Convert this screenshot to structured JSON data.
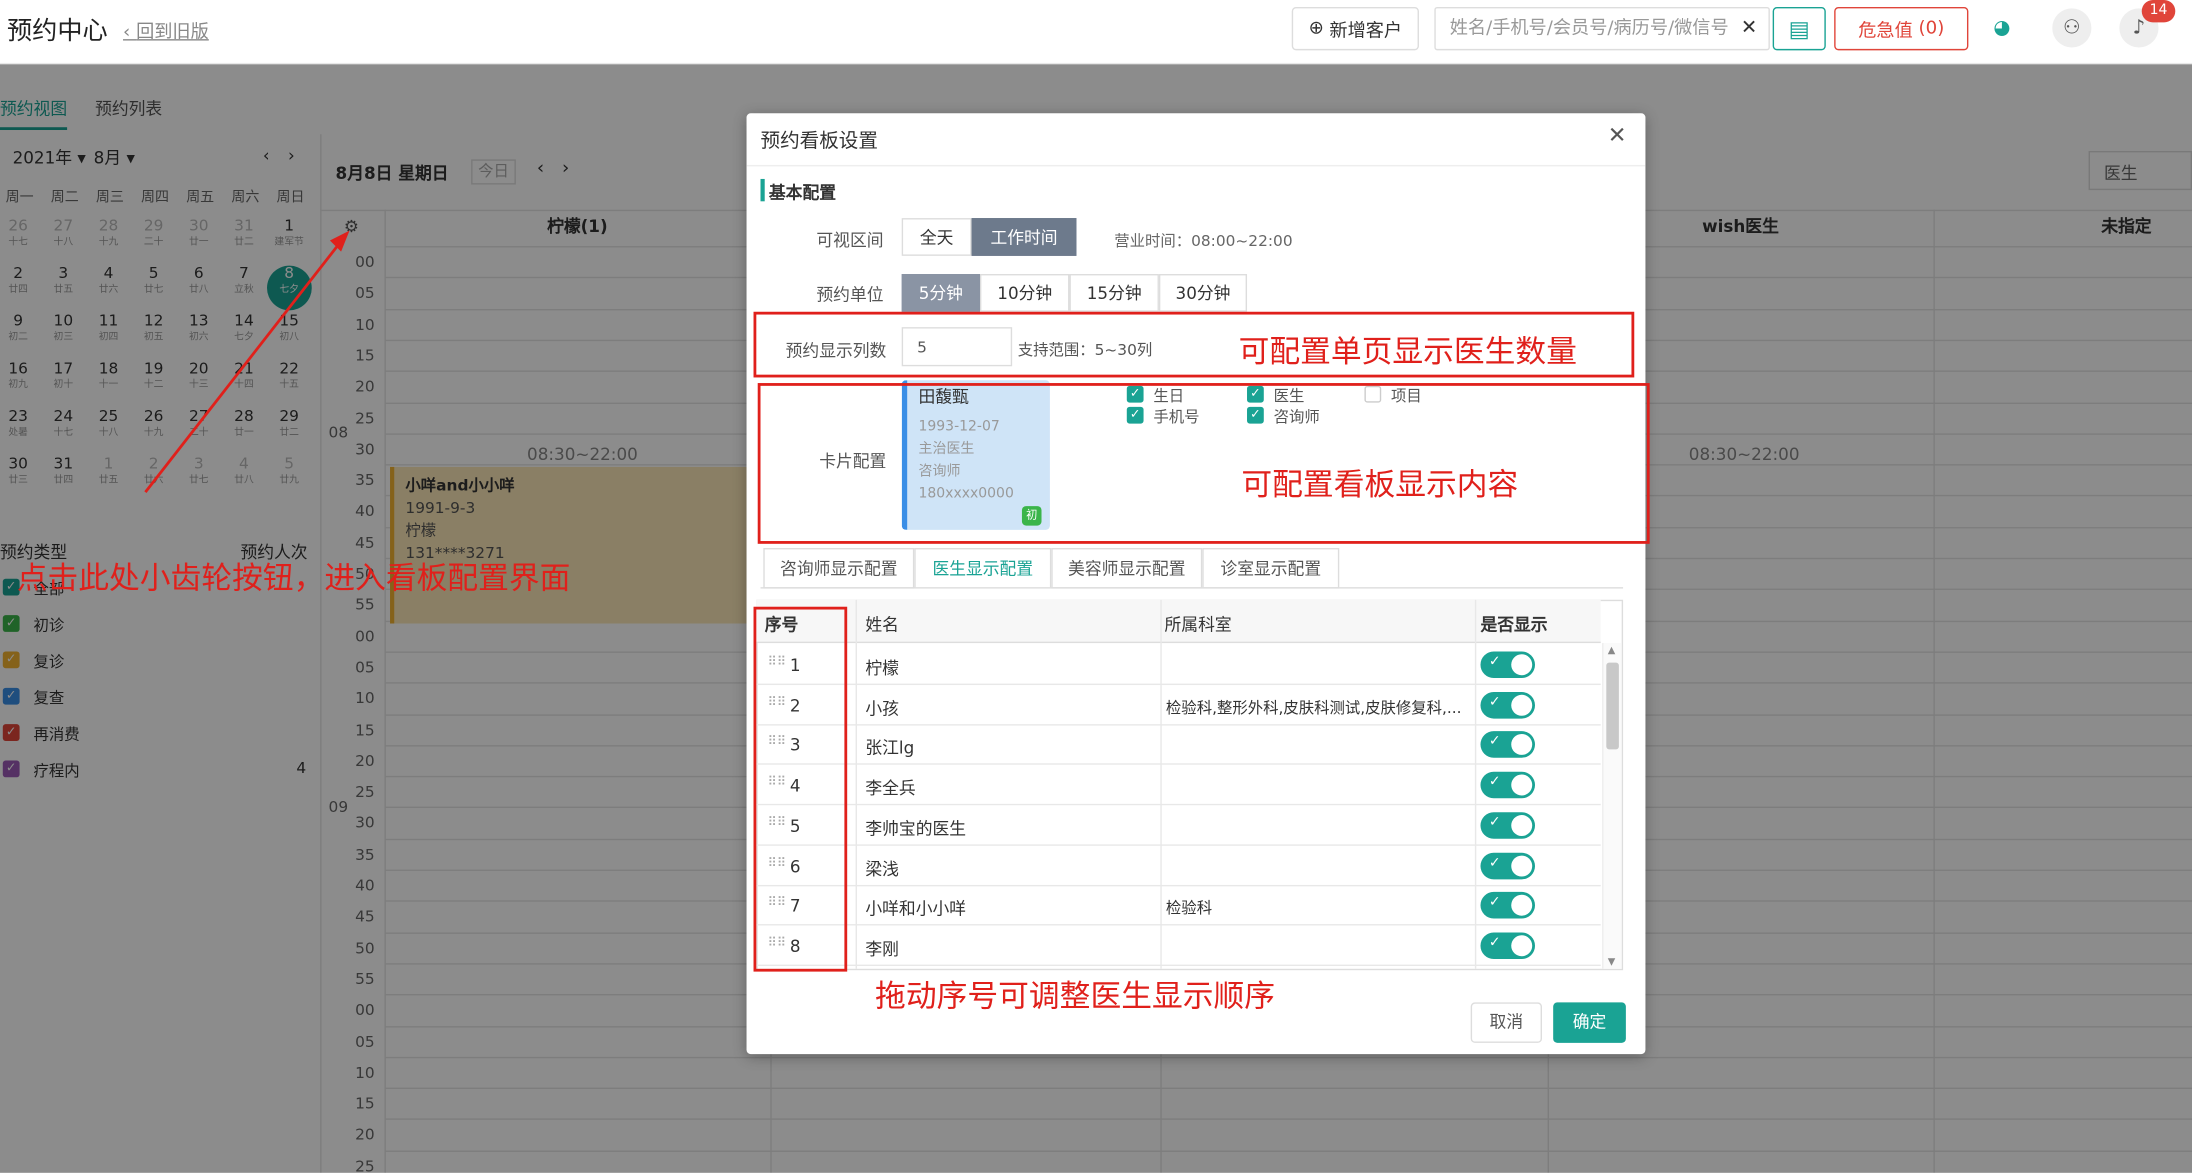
{
  "header": {
    "title": "预约中心",
    "back_link": "回到旧版",
    "new_customer": "新增客户",
    "search_placeholder": "姓名/手机号/会员号/病历号/微信号",
    "critical_label": "危急值",
    "critical_count": "0",
    "notif_count": "14"
  },
  "sidebar": {
    "tabs": [
      "预约视图",
      "预约列表"
    ],
    "year": "2021年",
    "month": "8月",
    "weekdays": [
      "周一",
      "周二",
      "周三",
      "周四",
      "周五",
      "周六",
      "周日"
    ],
    "weeks": [
      [
        [
          "26",
          "十七"
        ],
        [
          "27",
          "十八"
        ],
        [
          "28",
          "十九"
        ],
        [
          "29",
          "二十"
        ],
        [
          "30",
          "廿一"
        ],
        [
          "31",
          "廿二"
        ],
        [
          "1",
          "建军节"
        ]
      ],
      [
        [
          "2",
          "廿四"
        ],
        [
          "3",
          "廿五"
        ],
        [
          "4",
          "廿六"
        ],
        [
          "5",
          "廿七"
        ],
        [
          "6",
          "廿八"
        ],
        [
          "7",
          "立秋"
        ],
        [
          "8",
          "七夕"
        ]
      ],
      [
        [
          "9",
          "初二"
        ],
        [
          "10",
          "初三"
        ],
        [
          "11",
          "初四"
        ],
        [
          "12",
          "初五"
        ],
        [
          "13",
          "初六"
        ],
        [
          "14",
          "七夕"
        ],
        [
          "15",
          "初八"
        ]
      ],
      [
        [
          "16",
          "初九"
        ],
        [
          "17",
          "初十"
        ],
        [
          "18",
          "十一"
        ],
        [
          "19",
          "十二"
        ],
        [
          "20",
          "十三"
        ],
        [
          "21",
          "十四"
        ],
        [
          "22",
          "十五"
        ]
      ],
      [
        [
          "23",
          "处暑"
        ],
        [
          "24",
          "十七"
        ],
        [
          "25",
          "十八"
        ],
        [
          "26",
          "十九"
        ],
        [
          "27",
          "二十"
        ],
        [
          "28",
          "廿一"
        ],
        [
          "29",
          "廿二"
        ]
      ],
      [
        [
          "30",
          "廿三"
        ],
        [
          "31",
          "廿四"
        ],
        [
          "1",
          "廿五"
        ],
        [
          "2",
          "廿六"
        ],
        [
          "3",
          "廿七"
        ],
        [
          "4",
          "廿八"
        ],
        [
          "5",
          "廿九"
        ]
      ]
    ],
    "type_header": "预约类型",
    "count_header": "预约人次",
    "types": [
      {
        "label": "全部",
        "color": "#1aa394"
      },
      {
        "label": "初诊",
        "color": "#3bb54a"
      },
      {
        "label": "复诊",
        "color": "#f2b230"
      },
      {
        "label": "复查",
        "color": "#3a8ee6"
      },
      {
        "label": "再消费",
        "color": "#e0453a"
      },
      {
        "label": "疗程内",
        "color": "#9b59b6",
        "count": "4"
      }
    ]
  },
  "schedule": {
    "date": "8月8日 星期日",
    "today": "今日",
    "filter": "医生",
    "columns": [
      "柠檬(1)",
      "wish医生",
      "未指定"
    ],
    "hours": [
      "08",
      "09"
    ],
    "minutes": [
      "00",
      "05",
      "10",
      "15",
      "20",
      "25",
      "30",
      "35",
      "40",
      "45",
      "50",
      "55",
      "00",
      "05",
      "10",
      "15",
      "20",
      "25",
      "30",
      "35",
      "40",
      "45",
      "50",
      "55",
      "00",
      "05",
      "10",
      "15",
      "20",
      "25"
    ],
    "work_hours": "08:30~22:00",
    "appointment": {
      "name": "小咩and小小咩",
      "date": "1991-9-3",
      "doctor": "柠檬",
      "phone": "131****3271"
    }
  },
  "modal": {
    "title": "预约看板设置",
    "section": "基本配置",
    "visible_range": {
      "label": "可视区间",
      "options": [
        "全天",
        "工作时间"
      ],
      "selected": 1,
      "business_hours": "营业时间：08:00~22:00"
    },
    "unit": {
      "label": "预约单位",
      "options": [
        "5分钟",
        "10分钟",
        "15分钟",
        "30分钟"
      ],
      "selected": 0
    },
    "columns": {
      "label": "预约显示列数",
      "value": "5",
      "hint": "支持范围：5~30列"
    },
    "card": {
      "label": "卡片配置",
      "name": "田馥甄",
      "birth": "1993-12-07",
      "title": "主治医生",
      "role": "咨询师",
      "phone": "180xxxx0000",
      "badge": "初",
      "checks": [
        {
          "label": "生日",
          "on": true
        },
        {
          "label": "医生",
          "on": true
        },
        {
          "label": "项目",
          "on": false
        },
        {
          "label": "手机号",
          "on": true
        },
        {
          "label": "咨询师",
          "on": true
        }
      ]
    },
    "sub_tabs": [
      "咨询师显示配置",
      "医生显示配置",
      "美容师显示配置",
      "诊室显示配置"
    ],
    "sub_selected": 1,
    "table": {
      "headers": [
        "序号",
        "姓名",
        "所属科室",
        "是否显示"
      ],
      "rows": [
        [
          "1",
          "柠檬",
          ""
        ],
        [
          "2",
          "小孩",
          "检验科,整形外科,皮肤科测试,皮肤修复科,..."
        ],
        [
          "3",
          "张江lg",
          ""
        ],
        [
          "4",
          "李全兵",
          ""
        ],
        [
          "5",
          "李帅宝的医生",
          ""
        ],
        [
          "6",
          "梁浅",
          ""
        ],
        [
          "7",
          "小咩和小小咩",
          "检验科"
        ],
        [
          "8",
          "李刚",
          ""
        ]
      ]
    },
    "cancel": "取消",
    "ok": "确定"
  },
  "annotations": {
    "gear_hint": "点击此处小齿轮按钮，进入看板配置界面",
    "columns_hint": "可配置单页显示医生数量",
    "card_hint": "可配置看板显示内容",
    "order_hint": "拖动序号可调整医生显示顺序"
  },
  "colors": {
    "accent": "#1aa394",
    "annotation": "#e0201b"
  }
}
